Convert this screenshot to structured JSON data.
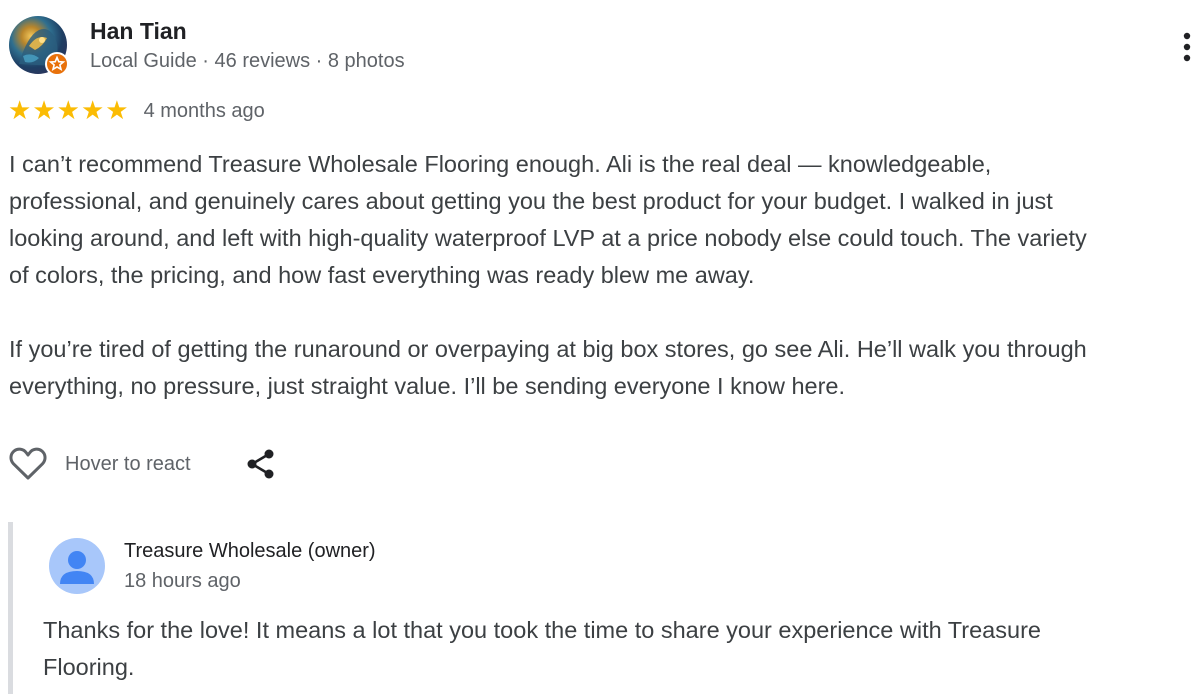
{
  "review": {
    "author": {
      "name": "Han Tian",
      "meta": "Local Guide · 46 reviews · 8 photos",
      "badge_icon": "local-guide-star-icon"
    },
    "rating": 5,
    "rating_max": 5,
    "stars": [
      "★",
      "★",
      "★",
      "★",
      "★"
    ],
    "date": "4 months ago",
    "text_lines_p1": [
      "I can’t recommend Treasure Wholesale Flooring enough. Ali is the real deal — knowledgeable,",
      "professional, and genuinely cares about getting you the best product for your budget. I walked in just",
      "looking around, and left with high-quality waterproof LVP at a price nobody else could touch. The variety",
      "of colors, the pricing, and how fast everything was ready blew me away."
    ],
    "text_lines_p2": [
      "If you’re tired of getting the runaround or overpaying at big box stores, go see Ali. He’ll walk you through",
      "everything, no pressure, just straight value. I’ll be sending everyone I know here."
    ],
    "actions": {
      "react_label": "Hover to react",
      "heart_icon": "heart-outline-icon",
      "share_icon": "share-icon",
      "more_icon": "more-vert-icon"
    }
  },
  "owner_reply": {
    "name": "Treasure Wholesale (owner)",
    "date": "18 hours ago",
    "text_lines": [
      "Thanks for the love! It means a lot that you took the time to share your experience with Treasure",
      "Flooring."
    ]
  },
  "colors": {
    "star": "#fbbc04",
    "badge": "#e8710a",
    "secondary_text": "#5f6368",
    "body_text": "#3c4043",
    "reply_border": "#dadce0",
    "owner_avatar_bg": "#a8c7fa",
    "owner_avatar_fg": "#4285f4"
  }
}
